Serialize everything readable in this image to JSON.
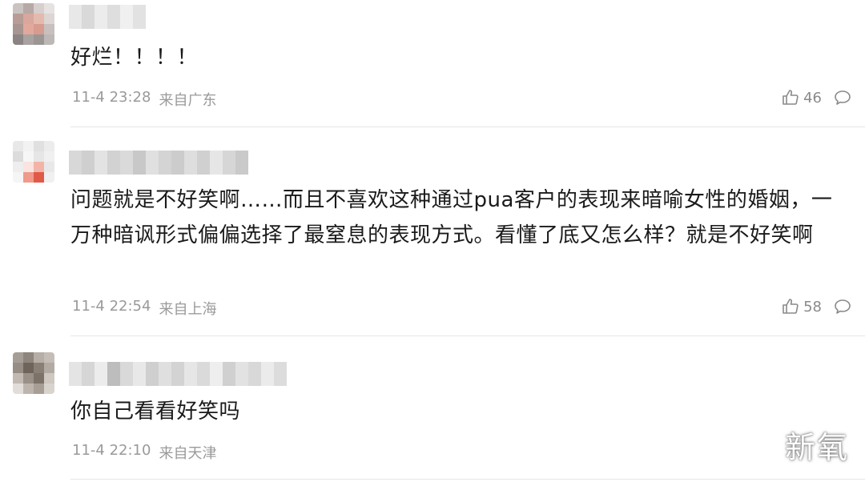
{
  "comments": [
    {
      "text": "好烂！！！！",
      "date": "11-4 23:28",
      "location": "来自广东",
      "likes": "46"
    },
    {
      "text": "问题就是不好笑啊……而且不喜欢这种通过pua客户的表现来暗喻女性的婚姻，一万种暗讽形式偏偏选择了最窒息的表现方式。看懂了底又怎么样？就是不好笑啊",
      "date": "11-4 22:54",
      "location": "来自上海",
      "likes": "58"
    },
    {
      "text": "你自己看看好笑吗",
      "date": "11-4 22:10",
      "location": "来自天津",
      "likes": ""
    }
  ],
  "icons": {
    "like": "thumbs-up-icon",
    "reply": "speech-bubble-icon"
  },
  "watermark": "新氧"
}
